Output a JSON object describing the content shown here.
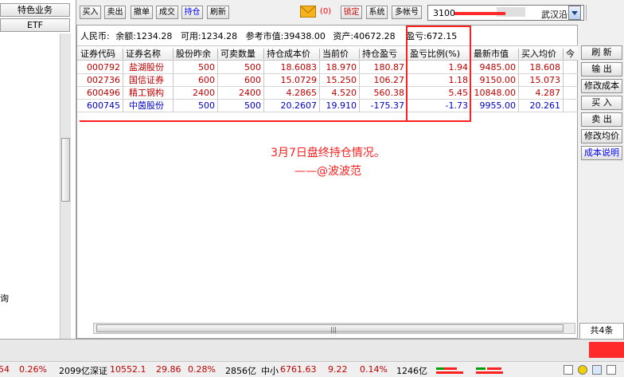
{
  "left_panel": {
    "tabs": [
      "特色业务",
      "ETF"
    ],
    "side_text": "询"
  },
  "toolbar": {
    "buttons": [
      "买入",
      "卖出",
      "撤单",
      "成交",
      "持仓",
      "刷新",
      "锁定",
      "系统",
      "多帐号"
    ],
    "active": "持仓",
    "mail_count": "(0)",
    "account_number": "3100",
    "account_place": "武汉沿"
  },
  "summary": {
    "currency": "人民币:",
    "balance_label": "余额:",
    "balance": "1234.28",
    "available_label": "可用:",
    "available": "1234.28",
    "ref_value_label": "参考市值:",
    "ref_value": "39438.00",
    "assets_label": "资产:",
    "assets": "40672.28",
    "pnl_label": "盈亏:",
    "pnl": "672.15"
  },
  "table": {
    "columns": [
      "证券代码",
      "证券名称",
      "股份昨余",
      "可卖数量",
      "持仓成本价",
      "当前价",
      "持仓盈亏",
      "盈亏比例(%)",
      "最新市值",
      "买入均价",
      "今"
    ],
    "rows": [
      [
        "000792",
        "盐湖股份",
        "500",
        "500",
        "18.6083",
        "18.970",
        "180.87",
        "1.94",
        "9485.00",
        "18.608"
      ],
      [
        "002736",
        "国信证券",
        "600",
        "600",
        "15.0729",
        "15.250",
        "106.27",
        "1.18",
        "9150.00",
        "15.073"
      ],
      [
        "600496",
        "精工钢构",
        "2400",
        "2400",
        "4.2865",
        "4.520",
        "560.38",
        "5.45",
        "10848.00",
        "4.287"
      ],
      [
        "600745",
        "中茵股份",
        "500",
        "500",
        "20.2607",
        "19.910",
        "-175.37",
        "-1.73",
        "9955.00",
        "20.261"
      ]
    ],
    "row_colors": [
      "#c00000",
      "#c00000",
      "#c00000",
      "#0000c8"
    ],
    "grip": "|||"
  },
  "annotation": {
    "line1": "3月7日盘终持仓情况。",
    "line2": "——@波波范"
  },
  "side_buttons": [
    "刷 新",
    "输 出",
    "修改成本",
    "买 入",
    "卖 出",
    "修改均价",
    "成本说明"
  ],
  "record_count": "共4条",
  "ticker": {
    "items": [
      "54",
      "0.26%",
      "2099亿",
      "深证",
      "10552.1",
      "29.86",
      "0.28%",
      "2856亿",
      "中小",
      "6761.63",
      "9.22",
      "0.14%",
      "1246亿"
    ]
  },
  "colors": {
    "up": "#c00000",
    "down": "#0000c8",
    "highlight": "#ff2020",
    "link": "#0000ff"
  }
}
